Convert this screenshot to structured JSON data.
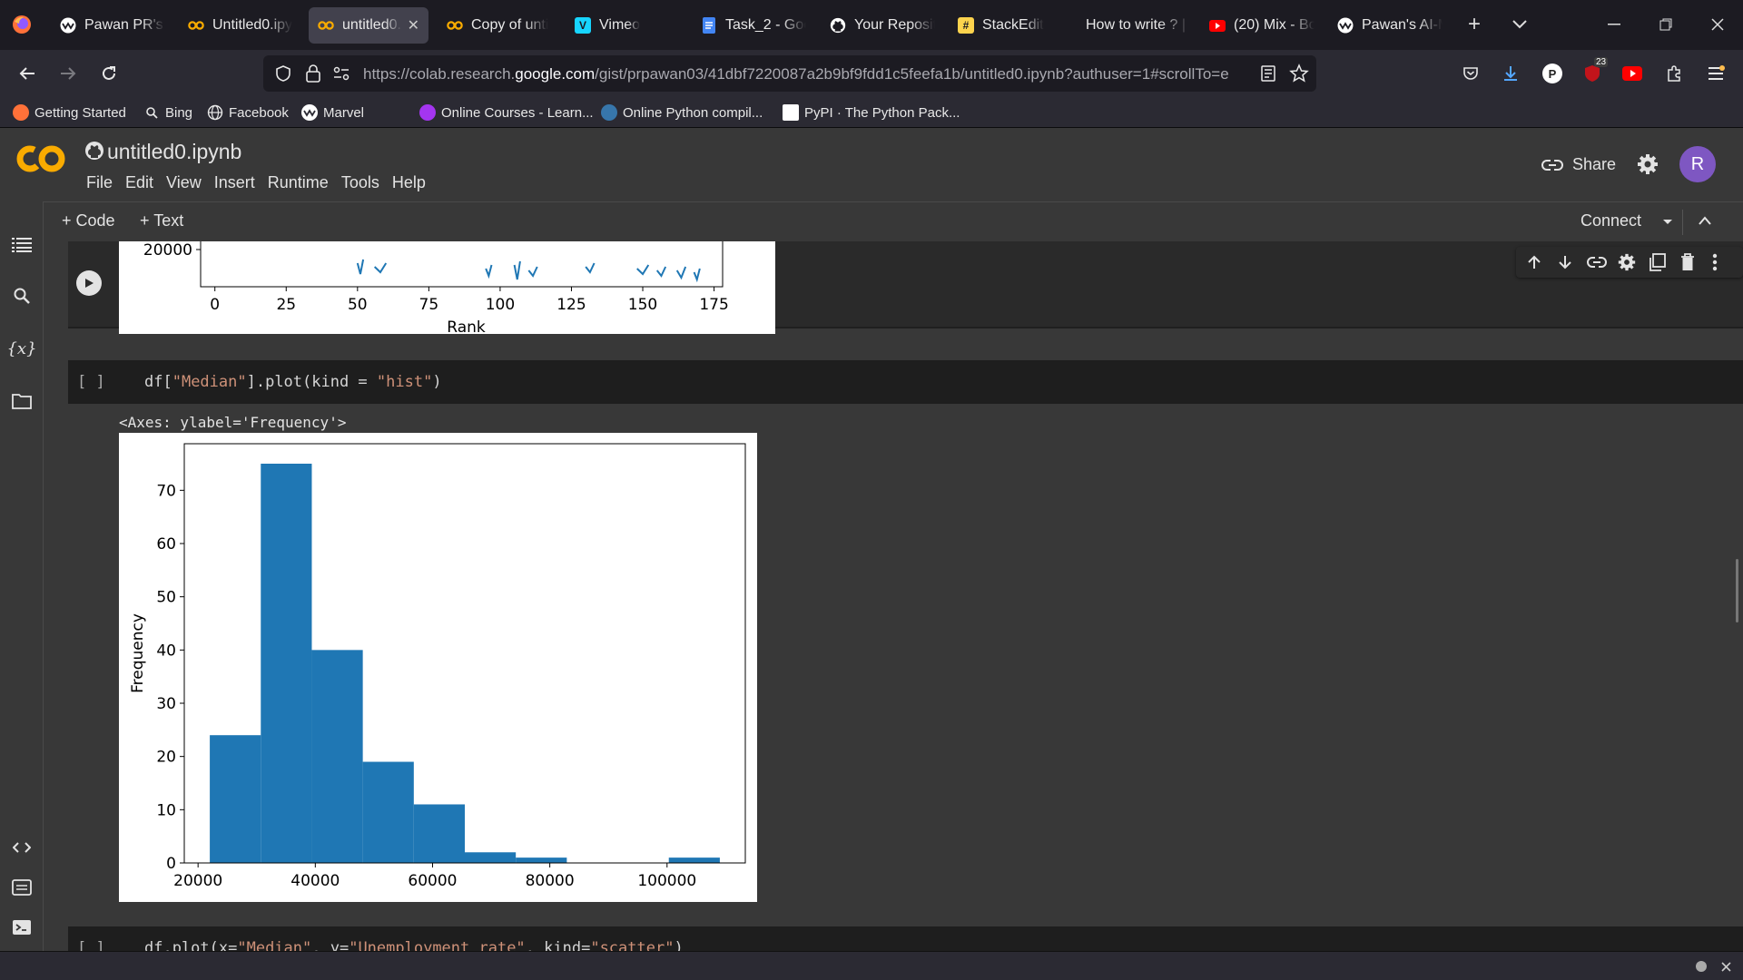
{
  "browser": {
    "tabs": [
      {
        "label": "Pawan PR's P",
        "icon": "wave-icon",
        "color": "#ffffff",
        "active": false
      },
      {
        "label": "Untitled0.ipy",
        "icon": "colab-icon",
        "color": "#f9ab00",
        "active": false
      },
      {
        "label": "untitled0.ip",
        "icon": "colab-icon",
        "color": "#f9ab00",
        "active": true
      },
      {
        "label": "Copy of unti",
        "icon": "colab-icon",
        "color": "#f9ab00",
        "active": false
      },
      {
        "label": "Vimeo",
        "icon": "vimeo-icon",
        "color": "#17d5ff",
        "active": false
      },
      {
        "label": "Task_2 - Goo",
        "icon": "docs-icon",
        "color": "#4285f4",
        "active": false
      },
      {
        "label": "Your Reposit",
        "icon": "github-icon",
        "color": "#ffffff",
        "active": false
      },
      {
        "label": "StackEdit",
        "icon": "stackedit-icon",
        "color": "#fcd34d",
        "active": false
      },
      {
        "label": "How to write ? | L",
        "icon": "",
        "color": "",
        "active": false
      },
      {
        "label": "(20) Mix - Bo",
        "icon": "youtube-icon",
        "color": "#ff0000",
        "active": false
      },
      {
        "label": "Pawan's AI-M",
        "icon": "wave-icon",
        "color": "#ffffff",
        "active": false
      }
    ],
    "url_prefix": "https://colab.research.",
    "url_domain": "google.com",
    "url_path": "/gist/prpawan03/41dbf7220087a2b9bf9fdd1c5feefa1b/untitled0.ipynb?authuser=1#scrollTo=e",
    "badge_count": "23",
    "profile_letter": "P",
    "bookmarks": [
      {
        "label": "Getting Started",
        "icon": "firefox-icon"
      },
      {
        "label": "Bing",
        "icon": "search-icon"
      },
      {
        "label": "Facebook",
        "icon": "globe-icon"
      },
      {
        "label": "Marvel",
        "icon": "wave-icon"
      },
      {
        "label": "Online Courses - Learn...",
        "icon": "udemy-icon"
      },
      {
        "label": "Online Python compil...",
        "icon": "python-icon"
      },
      {
        "label": "PyPI · The Python Pack...",
        "icon": "pypi-icon"
      }
    ]
  },
  "colab": {
    "title": "untitled0.ipynb",
    "menu": [
      "File",
      "Edit",
      "View",
      "Insert",
      "Runtime",
      "Tools",
      "Help"
    ],
    "share_label": "Share",
    "avatar_letter": "R",
    "add_code": "+ Code",
    "add_text": "+ Text",
    "connect_label": "Connect"
  },
  "cells": {
    "cell2_bracket": "[ ]",
    "cell2_code_pre": "df[",
    "cell2_code_str1": "\"Median\"",
    "cell2_code_mid": "].plot(kind = ",
    "cell2_code_str2": "\"hist\"",
    "cell2_code_post": ")",
    "cell2_output": "<Axes: ylabel='Frequency'>",
    "cell3_bracket": "[ ]",
    "cell3_code_pre": "df.plot(x=",
    "cell3_code_str1": "\"Median\"",
    "cell3_code_mid": ", y=",
    "cell3_code_str2": "\"Unemployment_rate\"",
    "cell3_code_mid2": ", kind=",
    "cell3_code_str3": "\"scatter\"",
    "cell3_code_post": ")"
  },
  "chart_data": [
    {
      "type": "line",
      "xlabel": "Rank",
      "x_ticks": [
        0,
        25,
        50,
        75,
        100,
        125,
        150,
        175
      ],
      "xlim": [
        -5,
        178
      ],
      "visible_y_tick": 20000
    },
    {
      "type": "bar",
      "ylabel": "Frequency",
      "bins": [
        {
          "start": 22000,
          "end": 30700,
          "count": 24
        },
        {
          "start": 30700,
          "end": 39400,
          "count": 75
        },
        {
          "start": 39400,
          "end": 48100,
          "count": 40
        },
        {
          "start": 48100,
          "end": 56800,
          "count": 19
        },
        {
          "start": 56800,
          "end": 65500,
          "count": 11
        },
        {
          "start": 65500,
          "end": 74200,
          "count": 2
        },
        {
          "start": 74200,
          "end": 82900,
          "count": 1
        },
        {
          "start": 82900,
          "end": 91600,
          "count": 0
        },
        {
          "start": 91600,
          "end": 100300,
          "count": 0
        },
        {
          "start": 100300,
          "end": 109000,
          "count": 1
        }
      ],
      "x_ticks": [
        20000,
        40000,
        60000,
        80000,
        100000
      ],
      "y_ticks": [
        0,
        10,
        20,
        30,
        40,
        50,
        60,
        70
      ],
      "xlim": [
        17650,
        113350
      ],
      "ylim": [
        0,
        78.75
      ],
      "bar_color": "#1f77b4"
    }
  ]
}
